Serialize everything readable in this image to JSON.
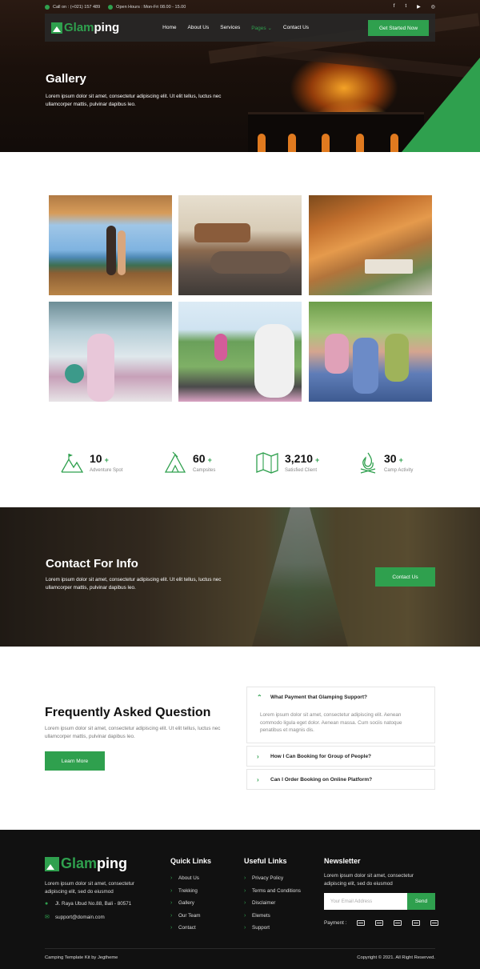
{
  "topbar": {
    "phone": "Call on : (+021) 157 489",
    "hours": "Open Hours : Mon-Fri 08.00 - 15.00",
    "social": [
      "facebook-icon",
      "twitter-icon",
      "youtube-icon",
      "instagram-icon"
    ]
  },
  "brand": {
    "part1": "Glam",
    "part2": "ping"
  },
  "nav": {
    "items": [
      "Home",
      "About Us",
      "Services",
      "Pages",
      "Contact Us"
    ],
    "active": "Pages",
    "cta": "Get Started Now"
  },
  "hero": {
    "title": "Gallery",
    "text": "Lorem ipsum dolor sit amet, consectetur adipiscing elit. Ut elit tellus, luctus nec ullamcorper mattis, pulvinar dapibus leo."
  },
  "gallery": [
    "couple-on-deck-photo",
    "couple-in-tent-photo",
    "tent-village-photo",
    "girl-in-dome-photo",
    "yoga-group-photo",
    "happy-friends-photo"
  ],
  "stats": [
    {
      "value": "10",
      "plus": "+",
      "label": "Adventure Spot",
      "icon": "mountain-icon"
    },
    {
      "value": "60",
      "plus": "+",
      "label": "Campsites",
      "icon": "tent-icon"
    },
    {
      "value": "3,210",
      "plus": "+",
      "label": "Satisfied Client",
      "icon": "map-icon"
    },
    {
      "value": "30",
      "plus": "+",
      "label": "Camp Activity",
      "icon": "campfire-icon"
    }
  ],
  "contact": {
    "title": "Contact For Info",
    "text": "Lorem ipsum dolor sit amet, consectetur adipiscing elit. Ut elit tellus, luctus nec ullamcorper mattis, pulvinar dapibus leo.",
    "button": "Contact Us"
  },
  "faq": {
    "title": "Frequently Asked Question",
    "text": "Lorem ipsum dolor sit amet, consectetur adipiscing elit. Ut elit tellus, luctus nec ullamcorper mattis, pulvinar dapibus leo.",
    "button": "Learn More",
    "items": [
      {
        "q": "What Payment that Glamping Support?",
        "a": "Lorem ipsum dolor sit amet, consectetur adipiscing elit. Aenean commodo ligula eget dolor. Aenean massa. Cum sociis natoque penatibus et magnis dis."
      },
      {
        "q": "How I Can Booking for Group of People?"
      },
      {
        "q": "Can I Order Booking on Online Platform?"
      }
    ]
  },
  "footer": {
    "desc": "Lorem ipsum dolor sit amet, consectetur adipiscing elit, sed do eiusmod",
    "address": "Jl. Raya Ubud No.88, Bali - 80571",
    "email": "support@domain.com",
    "quick_title": "Quick Links",
    "quick": [
      "About Us",
      "Trekking",
      "Gallery",
      "Our Team",
      "Contact"
    ],
    "useful_title": "Useful Links",
    "useful": [
      "Privacy Policy",
      "Terms and Conditions",
      "Disclaimer",
      "Elemets",
      "Support"
    ],
    "news_title": "Newsletter",
    "news_desc": "Lorem ipsum dolor sit amet, consectetur adipiscing elit, sed do eiusmod",
    "email_placeholder": "Your Email Address",
    "send": "Send",
    "payment_label": "Payment :",
    "payments": [
      "visa-icon",
      "mastercard-icon",
      "paypal-icon",
      "amex-icon",
      "stripe-icon"
    ],
    "copy_left": "Camping Template Kit by Jegtheme",
    "copy_right": "Copyright © 2021. All Right Reserved."
  },
  "colors": {
    "accent": "#2fa04e",
    "dark": "#111111"
  }
}
